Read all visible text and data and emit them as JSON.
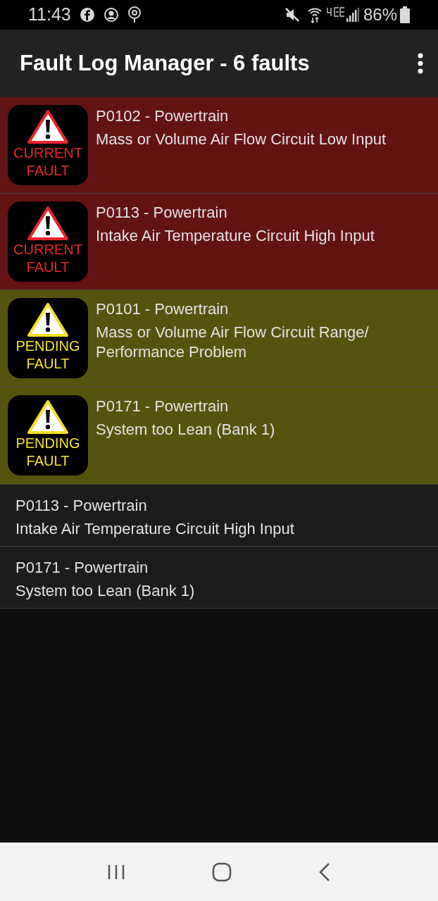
{
  "status_bar": {
    "time": "11:43",
    "battery": "86%"
  },
  "toolbar": {
    "title": "Fault Log Manager - 6 faults"
  },
  "faults": [
    {
      "kind": "current",
      "badge": [
        "CURRENT",
        "FAULT"
      ],
      "code": "P0102 - Powertrain",
      "description": "Mass or Volume Air Flow Circuit Low Input"
    },
    {
      "kind": "current",
      "badge": [
        "CURRENT",
        "FAULT"
      ],
      "code": "P0113 - Powertrain",
      "description": "Intake Air Temperature Circuit High Input"
    },
    {
      "kind": "pending",
      "badge": [
        "PENDING",
        "FAULT"
      ],
      "code": "P0101 - Powertrain",
      "description": "Mass or Volume Air Flow Circuit Range/ Performance Problem"
    },
    {
      "kind": "pending",
      "badge": [
        "PENDING",
        "FAULT"
      ],
      "code": "P0171 - Powertrain",
      "description": "System too Lean (Bank 1)"
    },
    {
      "kind": "history",
      "code": "P0113 - Powertrain",
      "description": "Intake Air Temperature Circuit High Input"
    },
    {
      "kind": "history",
      "code": "P0171 - Powertrain",
      "description": "System too Lean (Bank 1)"
    }
  ]
}
